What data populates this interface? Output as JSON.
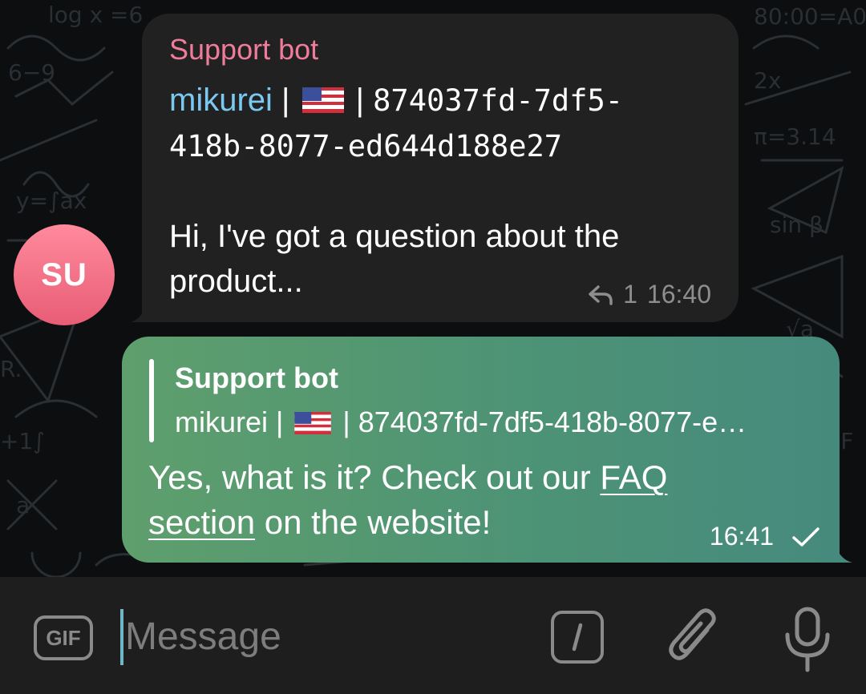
{
  "chat": {
    "incoming": {
      "avatar_initials": "SU",
      "sender": "Support bot",
      "username": "mikurei",
      "separator": " | ",
      "flag": "us-flag",
      "id_line1": "874037fd-7df5-",
      "id_line2": "418b-8077-ed644d188e27",
      "text_line1": "Hi, I've got a question about the",
      "text_line2": "product...",
      "reply_count": "1",
      "time": "16:40",
      "reply_icon": "reply-arrow-icon"
    },
    "outgoing": {
      "quote_title": "Support bot",
      "quote_username": "mikurei",
      "quote_separator": " | ",
      "quote_rest": " | 874037fd-7df5-418b-8077-e…",
      "text_part1": "Yes, what is it? Check out our ",
      "link_part1": "FAQ",
      "link_part2": "section",
      "text_part2": " on the website!",
      "time": "16:41",
      "status_icon": "check-icon"
    }
  },
  "input_bar": {
    "gif_label": "GIF",
    "placeholder": "Message",
    "icons": [
      "gif-icon",
      "command-icon",
      "paperclip-icon",
      "microphone-icon"
    ]
  },
  "colors": {
    "incoming_bubble": "#212121",
    "sender_name": "#f07c9b",
    "username_link": "#7bc8f0",
    "outgoing_bubble_start": "#5f9f6d",
    "outgoing_bubble_end": "#468a7d",
    "avatar": "#ee6b82",
    "input_bar": "#1e1e1e"
  }
}
